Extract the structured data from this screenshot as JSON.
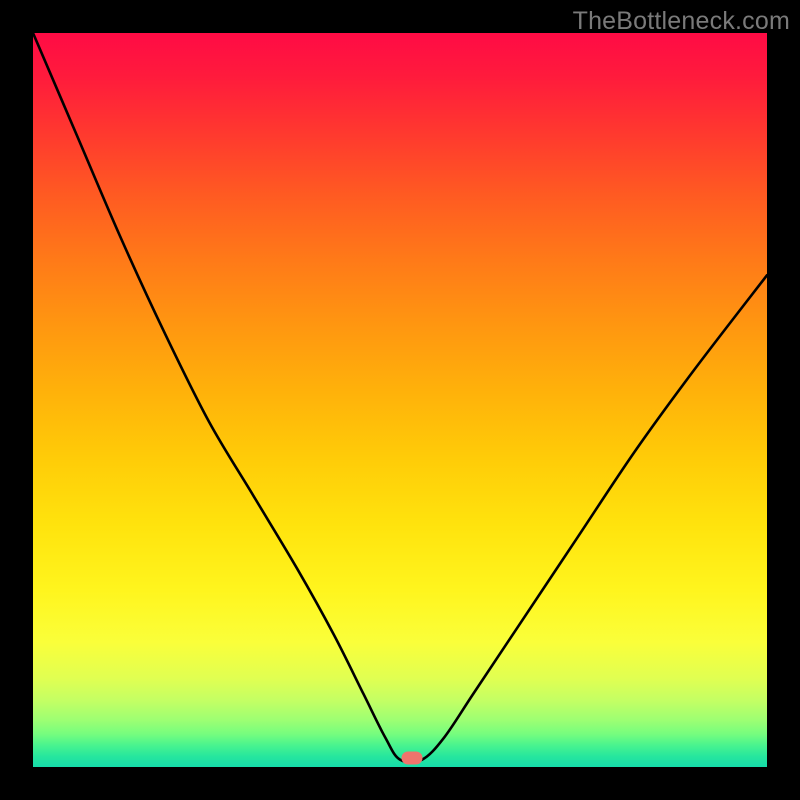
{
  "watermark": "TheBottleneck.com",
  "marker": {
    "x_pct": 51.6,
    "y_pct": 98.8
  },
  "chart_data": {
    "type": "line",
    "title": "",
    "xlabel": "",
    "ylabel": "",
    "xlim": [
      0,
      100
    ],
    "ylim": [
      0,
      100
    ],
    "series": [
      {
        "name": "bottleneck-curve",
        "x": [
          0,
          6,
          12,
          18,
          24,
          30,
          36,
          41,
          45,
          48,
          50,
          53,
          56,
          60,
          66,
          74,
          82,
          90,
          100
        ],
        "y": [
          100,
          86,
          72,
          59,
          47,
          37,
          27,
          18,
          10,
          4,
          1,
          1,
          4,
          10,
          19,
          31,
          43,
          54,
          67
        ]
      }
    ],
    "annotations": [
      {
        "text": "optimal-point",
        "x": 51.6,
        "y": 1.2
      }
    ],
    "gradient_stops": [
      {
        "pct": 0,
        "color": "#ff0b45"
      },
      {
        "pct": 50,
        "color": "#ffcc08"
      },
      {
        "pct": 85,
        "color": "#f0ff40"
      },
      {
        "pct": 100,
        "color": "#16dcaa"
      }
    ]
  }
}
